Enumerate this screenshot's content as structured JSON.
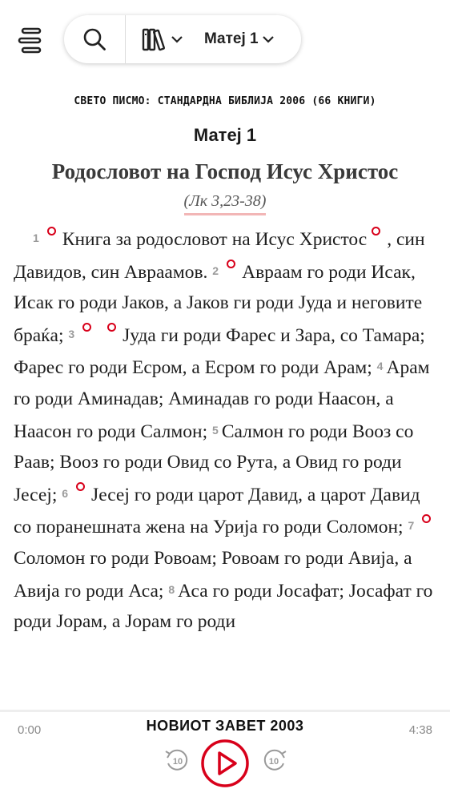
{
  "toolbar": {
    "chapter_label": "Матеј 1",
    "icons": [
      "menu-icon",
      "search-icon",
      "library-icon",
      "chevron-down-icon"
    ]
  },
  "reader": {
    "version_line": "СВЕТО ПИСМО: СТАНДАРДНА БИБЛИЈА 2006 (66 КНИГИ)",
    "chapter_title": "Матеј 1",
    "section_heading": "Родословот на Господ Исус Христос",
    "cross_reference": "(Лк 3,23-38)",
    "verses": [
      {
        "num": "1",
        "text": "Книга за родословот на Исус Христос",
        "note_after": true,
        "text2": ", син Давидов, син Авраамов."
      },
      {
        "num": "2",
        "text": "Авраам го роди Исак, Исак го роди Јаков, а Јаков ги роди Јуда и неговите браќа;"
      },
      {
        "num": "3",
        "text": "Јуда ги роди Фарес и Зара, со Тамара; Фарес го роди Есром, а Есром го роди Арам;"
      },
      {
        "num": "4",
        "text": "Арам го роди Аминадав; Аминадав го роди Наасон, а Наасон го роди Салмон;"
      },
      {
        "num": "5",
        "text": "Салмон го роди Вооз со Раав; Вооз го роди Овид со Рута, а Овид го роди Јесеј;"
      },
      {
        "num": "6",
        "text": "Јесеј го роди царот Давид, а царот Давид со поранешната жена на Урија го роди Соломон;"
      },
      {
        "num": "7",
        "text": "Соломон го роди Ровоам; Ровоам го роди Авија, а Авија го роди Аса;"
      },
      {
        "num": "8",
        "text": "Аса го роди Јосафат; Јосафат го роди Јорам, а Јорам го роди"
      }
    ]
  },
  "audio": {
    "title": "НОВИОТ ЗАВЕТ 2003",
    "current_time": "0:00",
    "total_time": "4:38",
    "progress": 0,
    "skip_back_label": "10",
    "skip_forward_label": "10"
  },
  "colors": {
    "accent": "#d8001a",
    "highlight_underline": "#f2b6b6",
    "text": "#1e1e1e",
    "muted": "#8a8a8a"
  }
}
